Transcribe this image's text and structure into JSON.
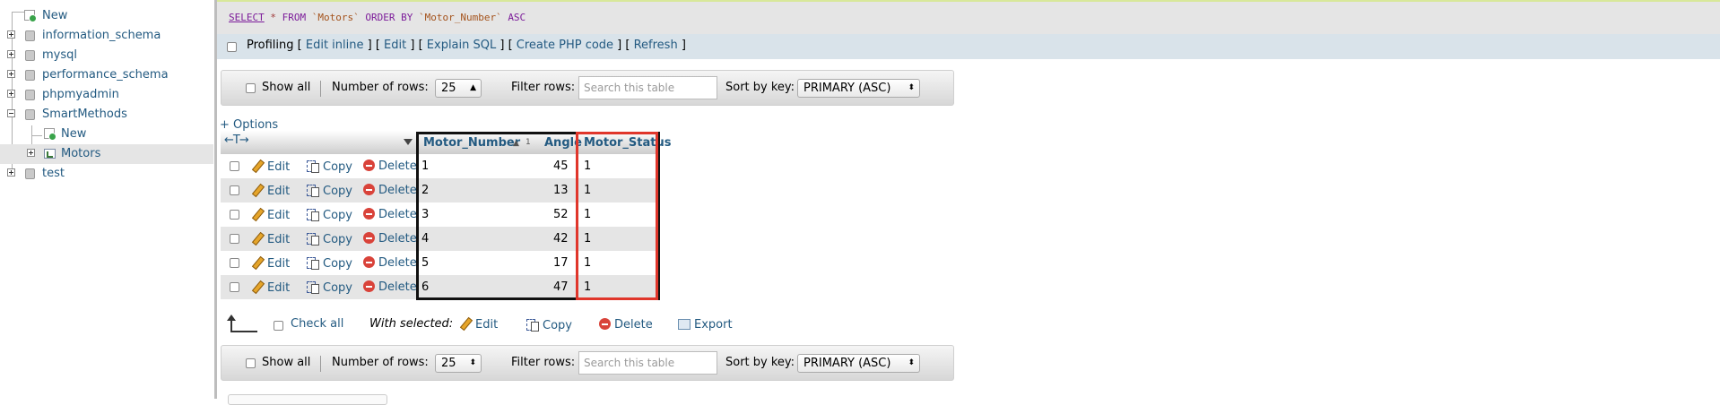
{
  "nav": {
    "items": [
      {
        "label": "New",
        "type": "new"
      },
      {
        "label": "information_schema",
        "type": "db"
      },
      {
        "label": "mysql",
        "type": "db"
      },
      {
        "label": "performance_schema",
        "type": "db"
      },
      {
        "label": "phpmyadmin",
        "type": "db"
      },
      {
        "label": "SmartMethods",
        "type": "db-open"
      },
      {
        "label": "New",
        "type": "new-child"
      },
      {
        "label": "Motors",
        "type": "table-child"
      },
      {
        "label": "test",
        "type": "db"
      }
    ]
  },
  "sql": {
    "select": "SELECT",
    "star": "*",
    "from": "FROM",
    "table": "`Motors`",
    "order_by": "ORDER BY",
    "column": "`Motor_Number`",
    "dir": "ASC"
  },
  "profiling": {
    "label": "Profiling",
    "open1": " [ ",
    "edit_inline": "Edit inline",
    "sep1": " ] [ ",
    "edit": "Edit",
    "sep2": " ] [ ",
    "explain": "Explain SQL",
    "sep3": " ] [ ",
    "create_php": "Create PHP code",
    "sep4": " ] [ ",
    "refresh": "Refresh",
    "close": " ]"
  },
  "navbar": {
    "show_all": "Show all",
    "num_rows_label": "Number of rows:",
    "num_rows_value": "25",
    "filter_label": "Filter rows:",
    "filter_placeholder": "Search this table",
    "sort_label": "Sort by key:",
    "sort_value": "PRIMARY (ASC)"
  },
  "options_link": "+ Options",
  "table": {
    "col_controls": "←T→",
    "headers": {
      "motor_number": "Motor_Number",
      "sort_index": "1",
      "angle": "Angle",
      "motor_status": "Motor_Status"
    },
    "actions": {
      "edit": "Edit",
      "copy": "Copy",
      "delete": "Delete"
    },
    "rows": [
      {
        "motor_number": "1",
        "angle": "45",
        "motor_status": "1"
      },
      {
        "motor_number": "2",
        "angle": "13",
        "motor_status": "1"
      },
      {
        "motor_number": "3",
        "angle": "52",
        "motor_status": "1"
      },
      {
        "motor_number": "4",
        "angle": "42",
        "motor_status": "1"
      },
      {
        "motor_number": "5",
        "angle": "17",
        "motor_status": "1"
      },
      {
        "motor_number": "6",
        "angle": "47",
        "motor_status": "1"
      }
    ]
  },
  "bulk": {
    "check_all": "Check all",
    "with_selected": "With selected:",
    "edit": "Edit",
    "copy": "Copy",
    "delete": "Delete",
    "export": "Export"
  },
  "colors": {
    "link": "#235a81",
    "highlight_red": "#e0362b",
    "highlight_black": "#111111"
  }
}
